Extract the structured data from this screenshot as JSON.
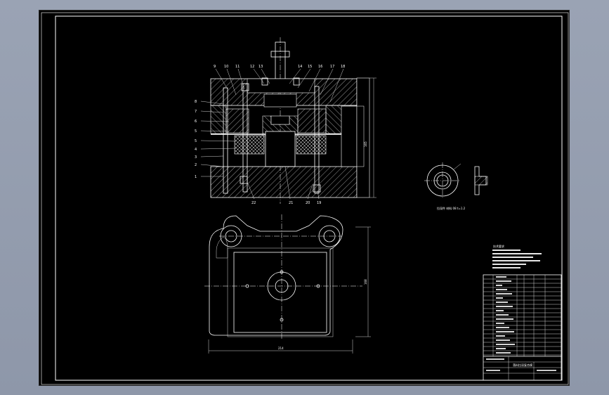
{
  "drawing": {
    "part_numbers_top": [
      "9",
      "10",
      "11",
      "12",
      "13",
      "14",
      "15",
      "16",
      "17",
      "18"
    ],
    "part_numbers_left": [
      "8",
      "7",
      "6",
      "5",
      "5",
      "4",
      "3",
      "2",
      "1"
    ],
    "part_numbers_bottom": [
      "22",
      "21",
      "20",
      "19"
    ],
    "side_dimension": "165",
    "plan_height_dim": "168",
    "plan_width_dim": "214",
    "part_caption": "拉深件 材料 08 t=1.2",
    "notes_title": "技术要求",
    "title_block_name": "落料拉深复合模"
  },
  "colors": {
    "background": "#9aa3b4",
    "sheet": "#000000",
    "lines": "#ffffff"
  }
}
